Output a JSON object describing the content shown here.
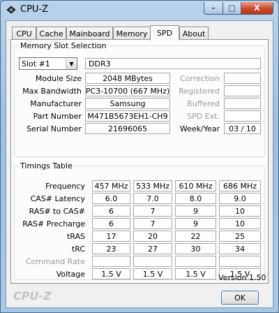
{
  "window": {
    "title": "CPU-Z"
  },
  "titlebar_buttons": {
    "minimize": "–",
    "maximize": "□",
    "close": "X"
  },
  "tabs": [
    "CPU",
    "Cache",
    "Mainboard",
    "Memory",
    "SPD",
    "About"
  ],
  "active_tab": "SPD",
  "memory_slot": {
    "group_title": "Memory Slot Selection",
    "slot_selected": "Slot #1",
    "type": "DDR3",
    "left": [
      {
        "label": "Module Size",
        "value": "2048 MBytes"
      },
      {
        "label": "Max Bandwidth",
        "value": "PC3-10700 (667 MHz)"
      },
      {
        "label": "Manufacturer",
        "value": "Samsung"
      },
      {
        "label": "Part Number",
        "value": "M471B5673EH1-CH9"
      },
      {
        "label": "Serial Number",
        "value": "21696065"
      }
    ],
    "right": [
      {
        "label": "Correction",
        "value": "",
        "disabled": true
      },
      {
        "label": "Registered",
        "value": "",
        "disabled": true
      },
      {
        "label": "Buffered",
        "value": "",
        "disabled": true
      },
      {
        "label": "SPD Ext.",
        "value": "",
        "disabled": true
      },
      {
        "label": "Week/Year",
        "value": "03 / 10",
        "disabled": false
      }
    ]
  },
  "timings": {
    "group_title": "Timings Table",
    "rows": [
      {
        "label": "Frequency",
        "values": [
          "457 MHz",
          "533 MHz",
          "610 MHz",
          "686 MHz"
        ]
      },
      {
        "label": "CAS# Latency",
        "values": [
          "6.0",
          "7.0",
          "8.0",
          "9.0"
        ]
      },
      {
        "label": "RAS# to CAS#",
        "values": [
          "6",
          "7",
          "9",
          "10"
        ]
      },
      {
        "label": "RAS# Precharge",
        "values": [
          "6",
          "7",
          "9",
          "10"
        ]
      },
      {
        "label": "tRAS",
        "values": [
          "17",
          "20",
          "22",
          "25"
        ]
      },
      {
        "label": "tRC",
        "values": [
          "23",
          "27",
          "30",
          "34"
        ]
      },
      {
        "label": "Command Rate",
        "values": [
          "",
          "",
          "",
          ""
        ],
        "disabled": true
      },
      {
        "label": "Voltage",
        "values": [
          "1.5 V",
          "1.5 V",
          "1.5 V",
          "1.5 V"
        ]
      }
    ]
  },
  "footer": {
    "brand": "CPU-Z",
    "version": "Version 1.50",
    "ok_label": "OK"
  }
}
